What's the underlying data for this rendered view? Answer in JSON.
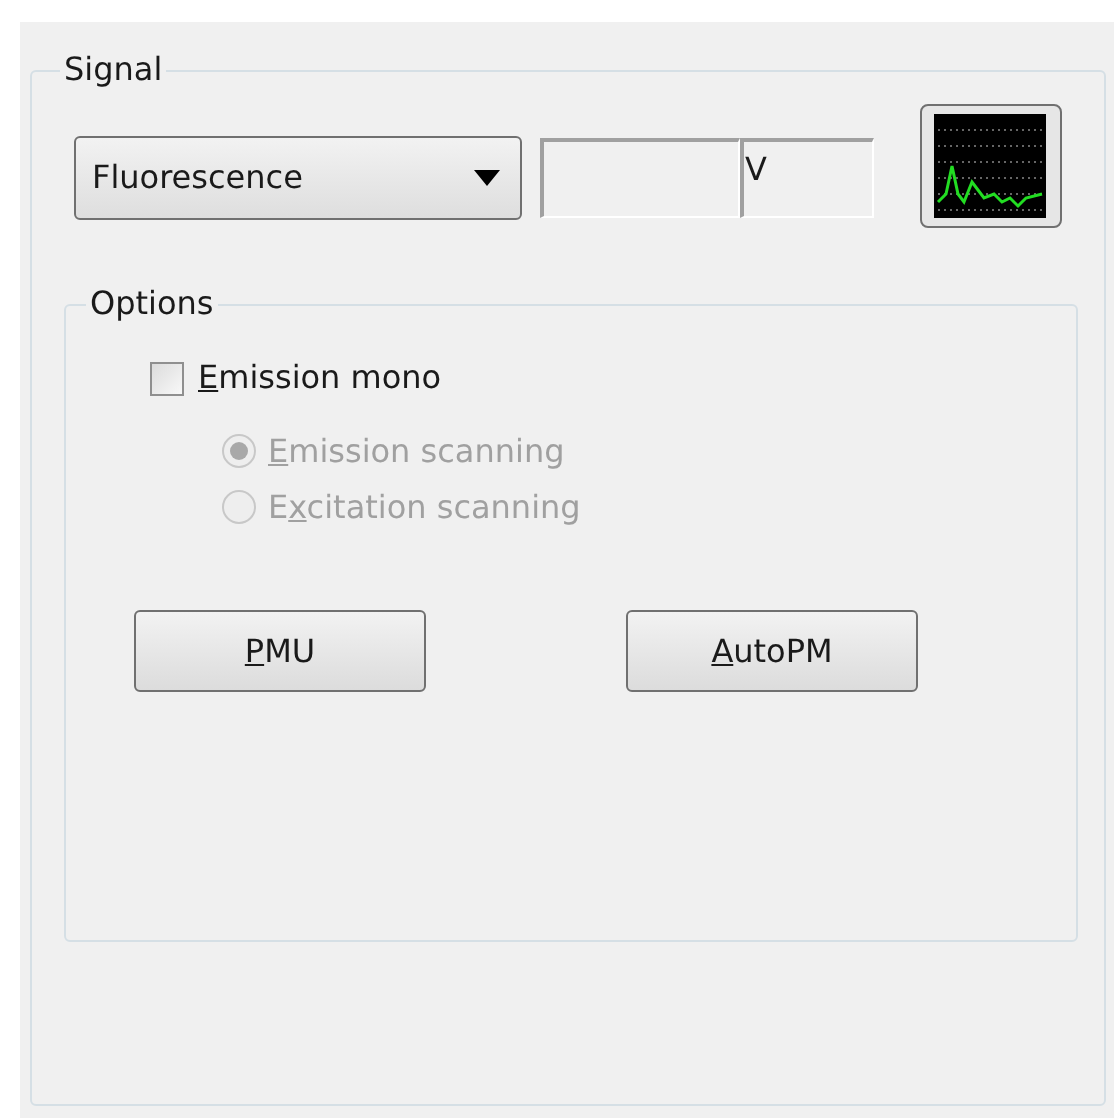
{
  "signal": {
    "title": "Signal",
    "dropdown": {
      "value": "Fluorescence"
    },
    "unit_field": {
      "value": "V"
    },
    "options": {
      "title": "Options",
      "checkbox": {
        "label": {
          "key": "E",
          "after": "mission mono"
        },
        "checked": false
      },
      "radios": [
        {
          "label": {
            "key": "E",
            "after": "mission scanning"
          },
          "selected": true,
          "disabled": true
        },
        {
          "label": {
            "before": "E",
            "key": "x",
            "after": "citation scanning"
          },
          "selected": false,
          "disabled": true
        }
      ],
      "buttons": [
        {
          "label": {
            "key": "P",
            "after": "MU"
          }
        },
        {
          "label": {
            "key": "A",
            "after": "utoPM"
          }
        }
      ]
    }
  }
}
